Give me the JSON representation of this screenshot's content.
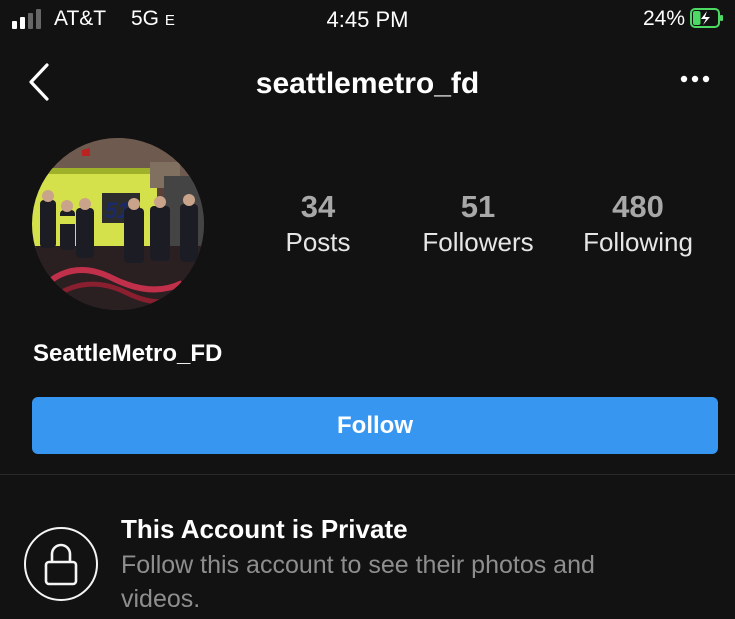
{
  "status_bar": {
    "carrier": "AT&T",
    "network": "5G",
    "network_suffix": "E",
    "time": "4:45 PM",
    "battery_percent": "24%",
    "battery_level": 0.24,
    "battery_color": "#4cd964",
    "signal_bars_filled": 2,
    "signal_bars_total": 4
  },
  "nav": {
    "username": "seattlemetro_fd",
    "back_icon": "chevron-left-icon",
    "more_icon": "more-horizontal-icon"
  },
  "profile": {
    "avatar": "profile-photo",
    "display_name": "SeattleMetro_FD",
    "stats": {
      "posts": {
        "value": "34",
        "label": "Posts"
      },
      "followers": {
        "value": "51",
        "label": "Followers"
      },
      "following": {
        "value": "480",
        "label": "Following"
      }
    }
  },
  "follow_button": {
    "label": "Follow",
    "color": "#3797f0"
  },
  "private_notice": {
    "icon": "lock-icon",
    "title": "This Account is Private",
    "description": "Follow this account to see their photos and videos."
  },
  "theme": {
    "background": "#121212",
    "text_primary": "#ffffff",
    "text_secondary": "#8e8e8e"
  }
}
